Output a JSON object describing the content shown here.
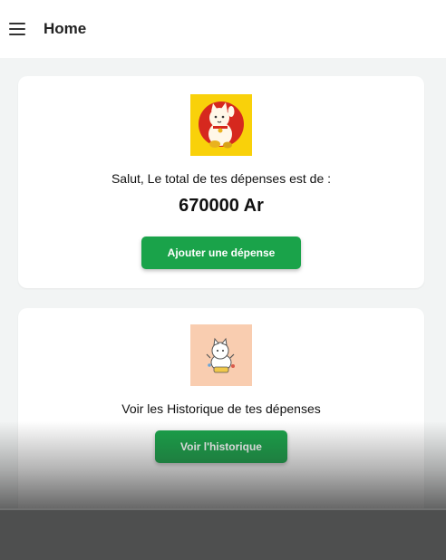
{
  "appbar": {
    "title": "Home",
    "menu_icon": "hamburger-menu-icon"
  },
  "expenses_card": {
    "image_icon": "lucky-cat-icon",
    "greeting": "Salut, Le total de tes dépenses est de :",
    "total": "670000 Ar",
    "button_label": "Ajouter une dépense"
  },
  "history_card": {
    "image_icon": "cat-illustration-icon",
    "text": "Voir les Historique de tes dépenses",
    "button_label": "Voir l'historique"
  },
  "colors": {
    "accent_green": "#1aa34a",
    "background": "#f2f4f4",
    "card": "#ffffff",
    "avatar_yellow": "#f9d10a",
    "avatar_peach": "#f9cdb0"
  }
}
